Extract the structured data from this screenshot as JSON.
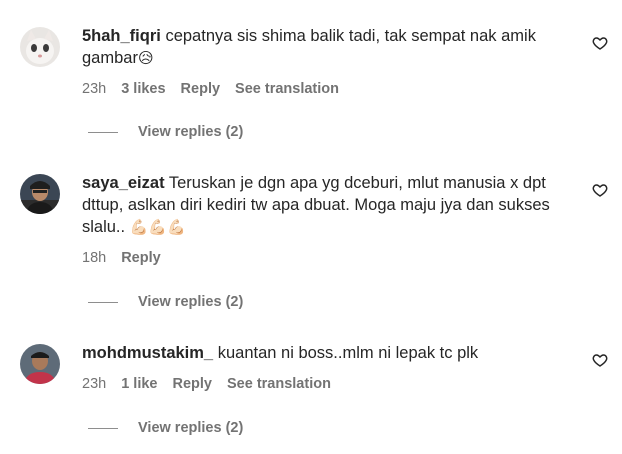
{
  "comments": [
    {
      "username": "5hah_fiqri",
      "text": "cepatnya sis shima balik tadi, tak sempat nak amik gambar",
      "emoji": "😥",
      "time": "23h",
      "likes": "3 likes",
      "reply_label": "Reply",
      "translate_label": "See translation",
      "view_replies": "View replies (2)",
      "avatar_icon": "cat-avatar"
    },
    {
      "username": "saya_eizat",
      "text": "Teruskan je dgn apa yg dceburi, mlut manusia x dpt dttup, aslkan diri kediri tw apa dbuat. Moga maju jya dan sukses slalu..",
      "emoji": "💪🏻💪🏻💪🏻",
      "time": "18h",
      "likes": "",
      "reply_label": "Reply",
      "translate_label": "",
      "view_replies": "View replies (2)",
      "avatar_icon": "person-avatar"
    },
    {
      "username": "mohdmustakim_",
      "text": "kuantan ni boss..mlm ni lepak tc plk",
      "emoji": "",
      "time": "23h",
      "likes": "1 like",
      "reply_label": "Reply",
      "translate_label": "See translation",
      "view_replies": "View replies (2)",
      "avatar_icon": "person-avatar"
    }
  ],
  "icons": {
    "like": "heart-outline-icon"
  },
  "colors": {
    "text": "#262626",
    "secondary": "#737373"
  }
}
